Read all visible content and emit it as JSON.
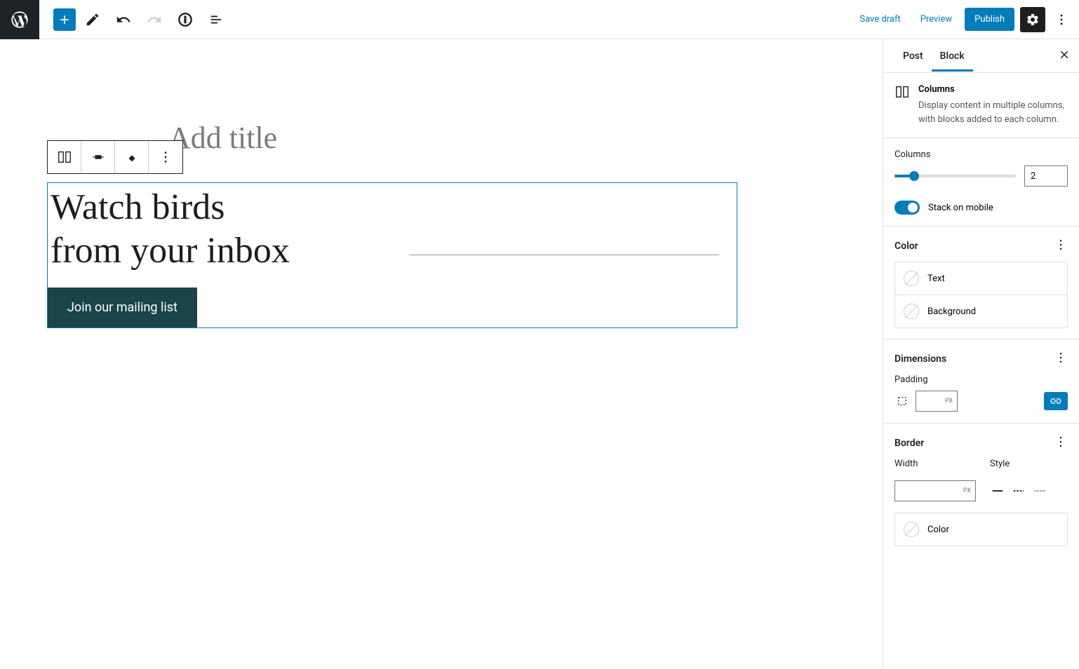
{
  "toolbar": {
    "save_draft": "Save draft",
    "preview": "Preview",
    "publish": "Publish"
  },
  "editor": {
    "title_placeholder": "Add title",
    "heading": "Watch birds\nfrom your inbox",
    "button_text": "Join our mailing list"
  },
  "sidebar": {
    "tabs": {
      "post": "Post",
      "block": "Block"
    },
    "block_info": {
      "title": "Columns",
      "description": "Display content in multiple columns, with blocks added to each column."
    },
    "columns": {
      "label": "Columns",
      "value": "2",
      "stack_label": "Stack on mobile",
      "stack_on": true
    },
    "color": {
      "title": "Color",
      "text": "Text",
      "background": "Background"
    },
    "dimensions": {
      "title": "Dimensions",
      "padding_label": "Padding",
      "unit": "PX"
    },
    "border": {
      "title": "Border",
      "width_label": "Width",
      "style_label": "Style",
      "unit": "PX",
      "color_label": "Color"
    }
  }
}
